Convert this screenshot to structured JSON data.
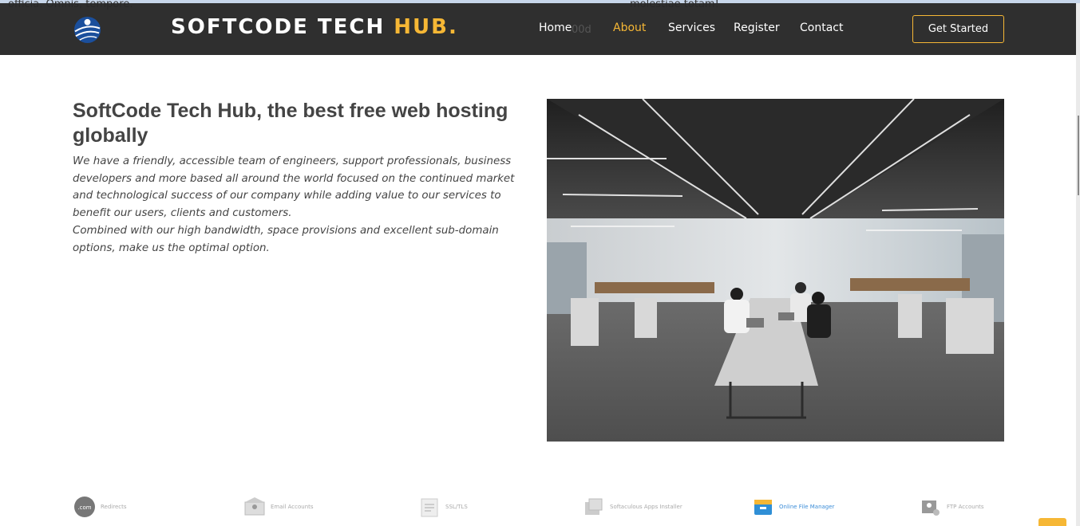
{
  "background_text": {
    "left": "officia. Omnis, tempore.",
    "right": "molestiae totam!",
    "ghost": "00d"
  },
  "header": {
    "brand_main": "SOFTCODE TECH ",
    "brand_accent": "HUB.",
    "nav": [
      {
        "label": "Home",
        "active": false
      },
      {
        "label": "About",
        "active": true
      },
      {
        "label": "Services",
        "active": false
      },
      {
        "label": "Register",
        "active": false
      },
      {
        "label": "Contact",
        "active": false
      }
    ],
    "cta_label": "Get Started"
  },
  "about": {
    "title": "SoftCode Tech Hub, the best free web hosting globally",
    "paragraph1": "We have a friendly, accessible team of engineers, support professionals, business developers and more based all around the world focused on the continued market and technological success of our company while adding value to our services to benefit our users, clients and customers.",
    "paragraph2": "Combined with our high bandwidth, space provisions and excellent sub-domain options, make us the optimal option."
  },
  "features": [
    {
      "label": "Redirects",
      "icon": "com-icon"
    },
    {
      "label": "Email Accounts",
      "icon": "email-accounts-icon"
    },
    {
      "label": "SSL/TLS",
      "icon": "ssl-icon"
    },
    {
      "label": "Softaculous Apps Installer",
      "icon": "apps-installer-icon"
    },
    {
      "label": "Online File Manager",
      "icon": "file-manager-icon"
    },
    {
      "label": "FTP Accounts",
      "icon": "ftp-accounts-icon"
    }
  ],
  "colors": {
    "accent": "#f6b735",
    "header_bg": "#282828",
    "link_blue": "#3c8dd8"
  }
}
